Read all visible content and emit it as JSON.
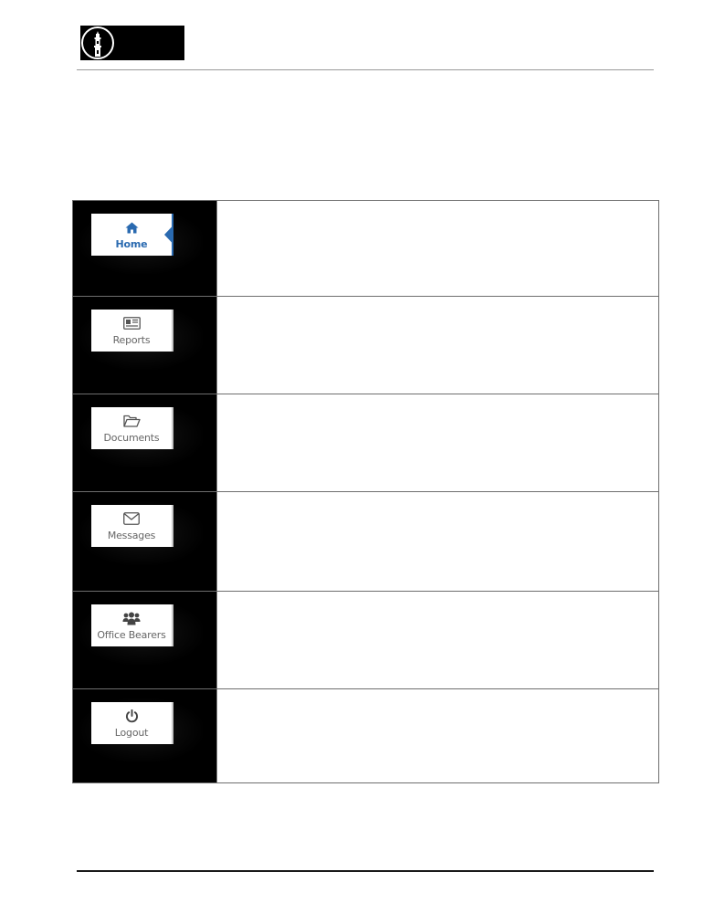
{
  "header": {
    "logo_icon": "minaret-logo-icon"
  },
  "menu_items": [
    {
      "label": "Home",
      "icon": "home-icon",
      "active": true
    },
    {
      "label": "Reports",
      "icon": "newspaper-icon",
      "active": false
    },
    {
      "label": "Documents",
      "icon": "folder-open-icon",
      "active": false
    },
    {
      "label": "Messages",
      "icon": "envelope-icon",
      "active": false
    },
    {
      "label": "Office Bearers",
      "icon": "users-icon",
      "active": false
    },
    {
      "label": "Logout",
      "icon": "power-icon",
      "active": false
    }
  ],
  "colors": {
    "active_accent": "#2a6ab0",
    "inactive_label": "#666666",
    "thumbnail_background": "#000000"
  }
}
